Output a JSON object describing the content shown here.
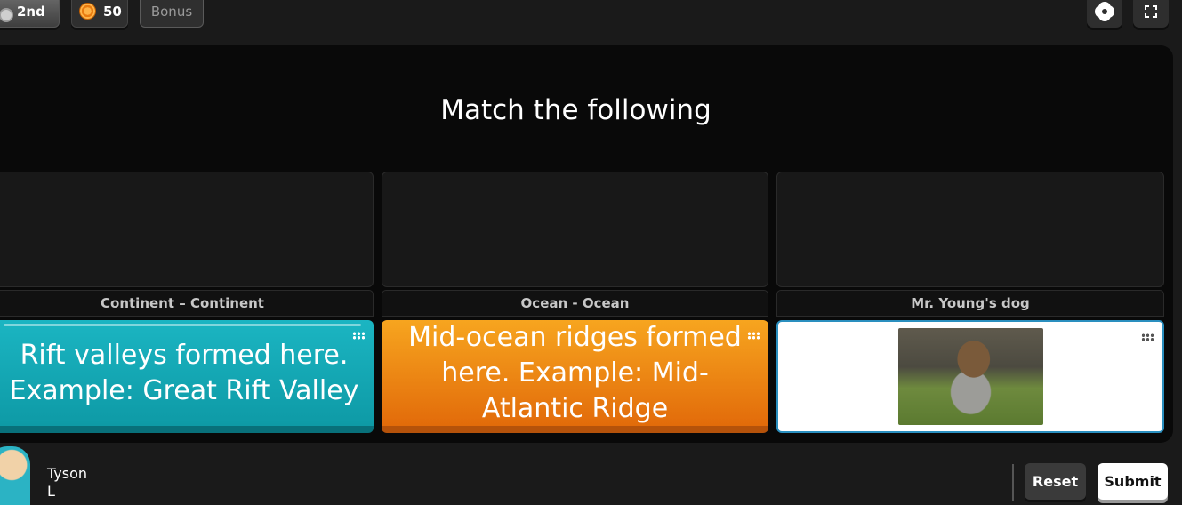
{
  "topbar": {
    "rank": "2nd",
    "coins": "50",
    "bonus_label": "Bonus"
  },
  "question": {
    "title": "Match the following"
  },
  "columns": [
    {
      "label": "Continent – Continent",
      "card_text": "Rift valleys formed here. Example: Great Rift Valley",
      "card_color": "#14a8b5"
    },
    {
      "label": "Ocean - Ocean",
      "card_text": "Mid-ocean ridges formed here. Example: Mid-Atlantic Ridge",
      "card_color": "#f08a14"
    },
    {
      "label": "Mr. Young's dog",
      "card_image": "dog-photo",
      "card_color": "#ffffff"
    }
  ],
  "player": {
    "first_name": "Tyson",
    "last_initial": "L"
  },
  "actions": {
    "reset_label": "Reset",
    "submit_label": "Submit"
  }
}
